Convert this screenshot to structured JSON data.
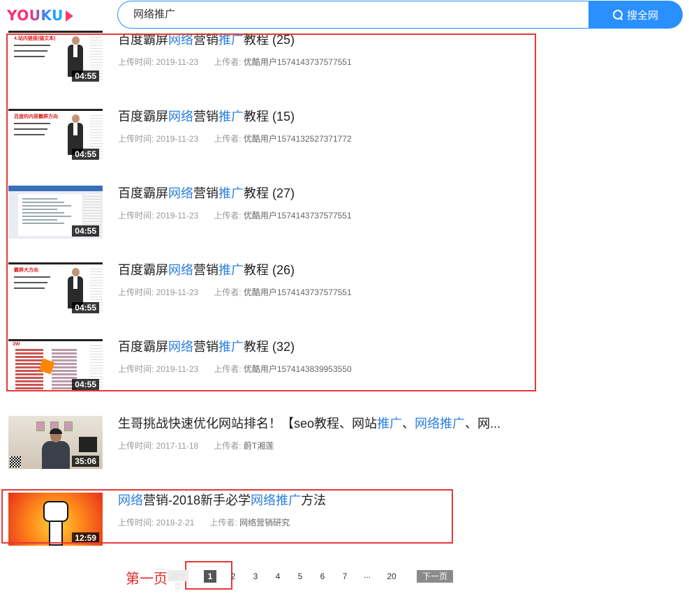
{
  "header": {
    "logo_text": "YOUKU",
    "search_value": "网络推广",
    "search_button_label": "搜全网"
  },
  "meta_labels": {
    "upload_time": "上传时间:",
    "uploader": "上传者:"
  },
  "results": [
    {
      "title_parts": [
        {
          "text": "百度霸屏",
          "highlight": false
        },
        {
          "text": "网络",
          "highlight": true
        },
        {
          "text": "营销",
          "highlight": false
        },
        {
          "text": "推广",
          "highlight": true
        },
        {
          "text": "教程 (25)",
          "highlight": false
        }
      ],
      "duration": "04:55",
      "upload_time": "2019-11-23",
      "uploader": "优酷用户1574143737577551",
      "thumb_type": "slide",
      "thumb_heading": "4.站内链接(锚文本)"
    },
    {
      "title_parts": [
        {
          "text": "百度霸屏",
          "highlight": false
        },
        {
          "text": "网络",
          "highlight": true
        },
        {
          "text": "营销",
          "highlight": false
        },
        {
          "text": "推广",
          "highlight": true
        },
        {
          "text": "教程 (15)",
          "highlight": false
        }
      ],
      "duration": "04:55",
      "upload_time": "2019-11-23",
      "uploader": "优酷用户1574132527371772",
      "thumb_type": "slide",
      "thumb_heading": "百度的内容霸屏方向"
    },
    {
      "title_parts": [
        {
          "text": "百度霸屏",
          "highlight": false
        },
        {
          "text": "网络",
          "highlight": true
        },
        {
          "text": "营销",
          "highlight": false
        },
        {
          "text": "推广",
          "highlight": true
        },
        {
          "text": "教程 (27)",
          "highlight": false
        }
      ],
      "duration": "04:55",
      "upload_time": "2019-11-23",
      "uploader": "优酷用户1574143737577551",
      "thumb_type": "doc",
      "thumb_heading": ""
    },
    {
      "title_parts": [
        {
          "text": "百度霸屏",
          "highlight": false
        },
        {
          "text": "网络",
          "highlight": true
        },
        {
          "text": "营销",
          "highlight": false
        },
        {
          "text": "推广",
          "highlight": true
        },
        {
          "text": "教程 (26)",
          "highlight": false
        }
      ],
      "duration": "04:55",
      "upload_time": "2019-11-23",
      "uploader": "优酷用户1574143737577551",
      "thumb_type": "slide",
      "thumb_heading": "霸屏大方向"
    },
    {
      "title_parts": [
        {
          "text": "百度霸屏",
          "highlight": false
        },
        {
          "text": "网络",
          "highlight": true
        },
        {
          "text": "营销",
          "highlight": false
        },
        {
          "text": "推广",
          "highlight": true
        },
        {
          "text": "教程 (32)",
          "highlight": false
        }
      ],
      "duration": "04:55",
      "upload_time": "2019-11-23",
      "uploader": "优酷用户1574143839953550",
      "thumb_type": "table",
      "thumb_heading": ""
    },
    {
      "title_parts": [
        {
          "text": "生哥挑战快速优化网站排名！【seo教程、网站",
          "highlight": false
        },
        {
          "text": "推广",
          "highlight": true
        },
        {
          "text": "、",
          "highlight": false
        },
        {
          "text": "网络推广",
          "highlight": true
        },
        {
          "text": "、网...",
          "highlight": false
        }
      ],
      "duration": "35:06",
      "upload_time": "2017-11-18",
      "uploader": "蔚T湘莲",
      "thumb_type": "video",
      "thumb_heading": ""
    },
    {
      "title_parts": [
        {
          "text": "网络",
          "highlight": true
        },
        {
          "text": "营销-2018新手必学",
          "highlight": false
        },
        {
          "text": "网络推广",
          "highlight": true
        },
        {
          "text": "方法",
          "highlight": false
        }
      ],
      "duration": "12:59",
      "upload_time": "2018-2-21",
      "uploader": "网络营销研究",
      "thumb_type": "fist",
      "thumb_heading": ""
    }
  ],
  "pagination": {
    "first_page_label": "第一页",
    "prev_label": "上一页",
    "current": "1",
    "pages": [
      "2",
      "3",
      "4",
      "5",
      "6",
      "7"
    ],
    "ellipsis": "...",
    "last": "20",
    "next_label": "下一页"
  },
  "colors": {
    "accent": "#2a8fff",
    "highlight": "#2a7fe0",
    "annotation": "#e53935"
  }
}
